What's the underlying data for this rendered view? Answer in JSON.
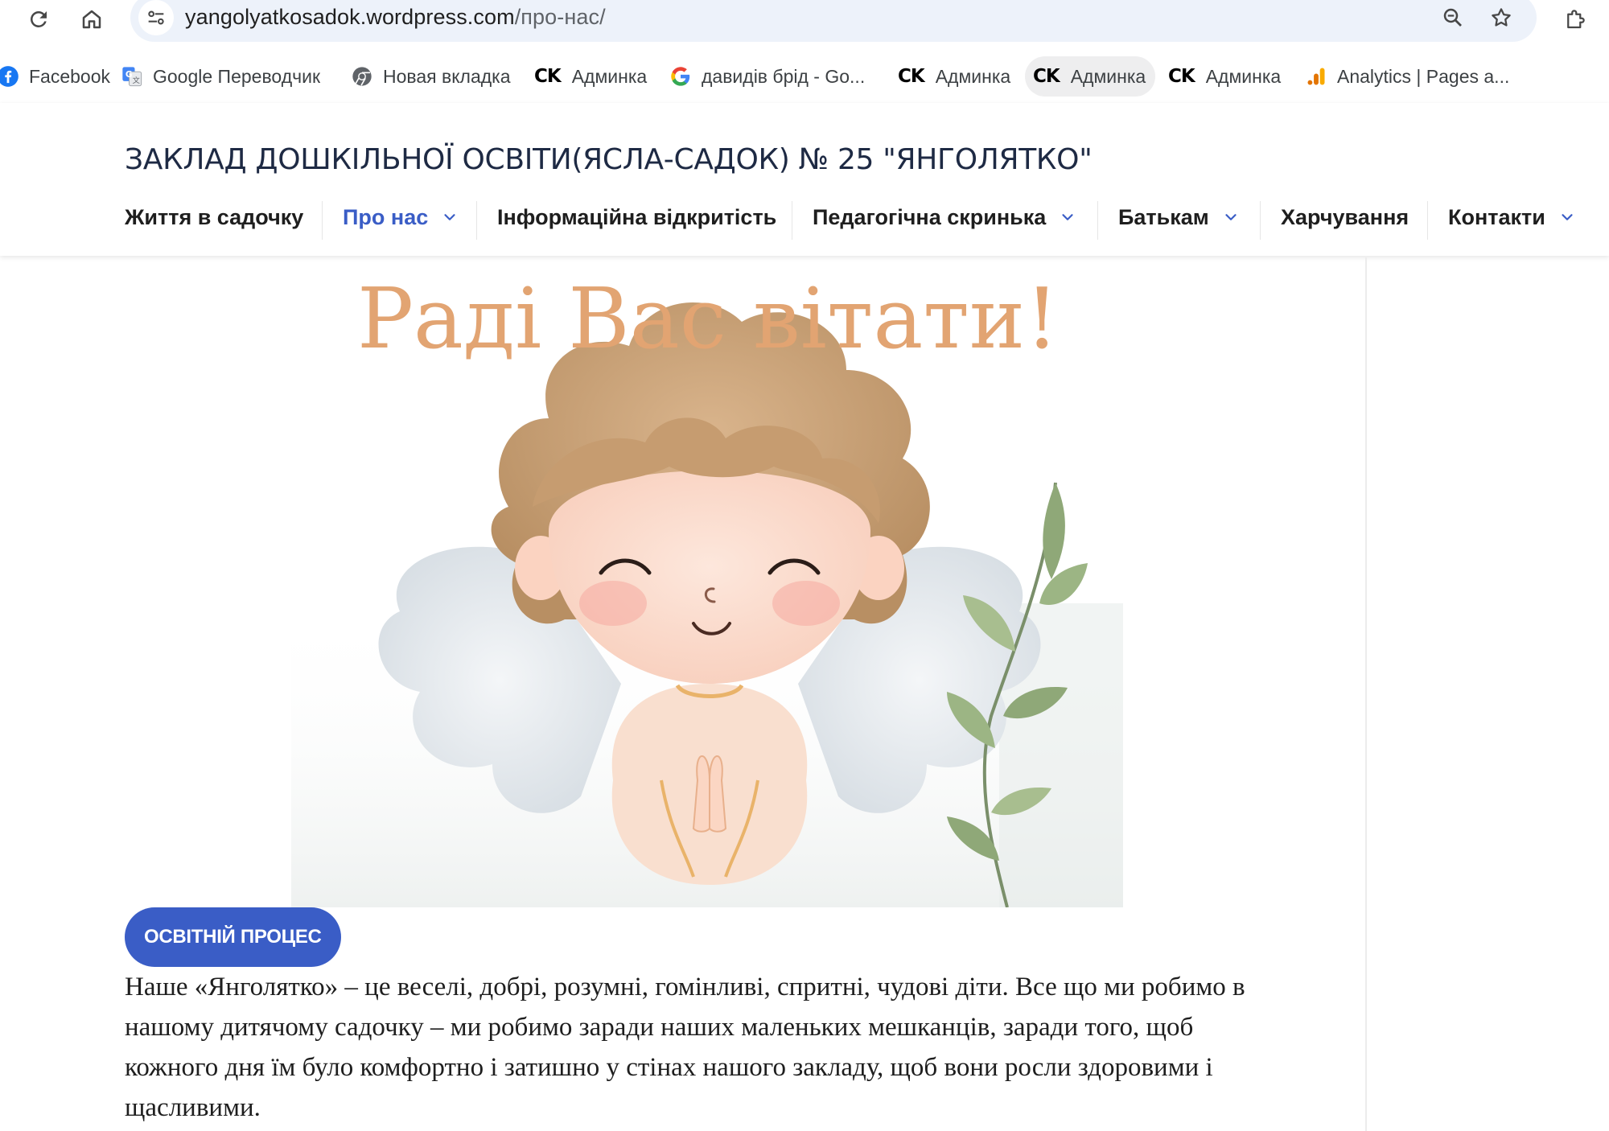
{
  "browser": {
    "url_host": "yangolyatkosadok.wordpress.com",
    "url_path": "/про-нас/",
    "bookmarks": [
      {
        "label": "Facebook",
        "icon": "facebook-icon"
      },
      {
        "label": "Google Переводчик",
        "icon": "google-translate-icon"
      },
      {
        "label": "Новая вкладка",
        "icon": "chrome-icon"
      },
      {
        "label": "Админка",
        "icon": "ck-logo",
        "logo_text": "CK"
      },
      {
        "label": "давидів брід - Go...",
        "icon": "google-icon"
      },
      {
        "label": "Админка",
        "icon": "ck-logo",
        "logo_text": "CK"
      },
      {
        "label": "Админка",
        "icon": "ck-logo",
        "logo_text": "CK"
      },
      {
        "label": "Админка",
        "icon": "ck-logo",
        "logo_text": "CK"
      },
      {
        "label": "Analytics | Pages a...",
        "icon": "analytics-icon"
      }
    ]
  },
  "site": {
    "title": "ЗАКЛАД ДОШКІЛЬНОЇ ОСВІТИ(ЯСЛА-САДОК) № 25 \"ЯНГОЛЯТКО\"",
    "accent_color": "#3a5dc6",
    "nav": [
      {
        "label": "Життя в садочку",
        "has_submenu": false,
        "current": false
      },
      {
        "label": "Про нас",
        "has_submenu": true,
        "current": true
      },
      {
        "label": "Інформаційна відкритість",
        "has_submenu": false,
        "current": false
      },
      {
        "label": "Педагогічна скринька",
        "has_submenu": true,
        "current": false
      },
      {
        "label": "Батькам",
        "has_submenu": true,
        "current": false
      },
      {
        "label": "Харчування",
        "has_submenu": false,
        "current": false
      },
      {
        "label": "Контакти",
        "has_submenu": true,
        "current": false
      }
    ]
  },
  "content": {
    "welcome_text": "Раді Вас вітати!",
    "welcome_color": "#e2a472",
    "category": "ОСВІТНІЙ ПРОЦЕС",
    "intro": "Наше «Янголятко» – це веселі, добрі, розумні, гомінливі, спритні, чудові діти. Все що ми робимо в нашому дитячому садочку – ми робимо заради наших маленьких мешканців, заради того, щоб кожного дня їм було комфортно і затишно у стінах нашого закладу, щоб вони росли здоровими і щасливими."
  }
}
